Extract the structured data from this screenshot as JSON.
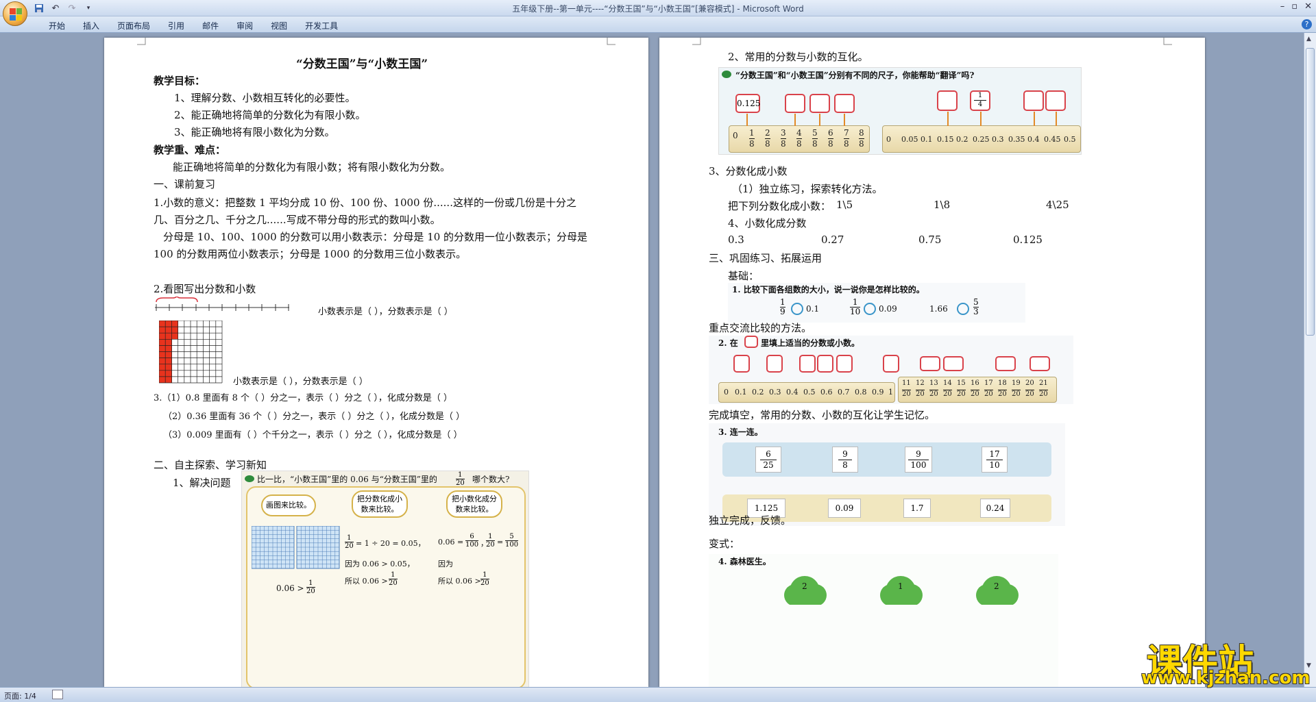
{
  "window": {
    "title": "五年级下册--第一单元----“分数王国”与“小数王国”[兼容模式] - Microsoft Word"
  },
  "ribbon": {
    "tabs": [
      "开始",
      "插入",
      "页面布局",
      "引用",
      "邮件",
      "审阅",
      "视图",
      "开发工具"
    ]
  },
  "status": {
    "page": "页面: 1/4"
  },
  "watermark": {
    "line1": "课件站",
    "line2": "www.kjzhan.com"
  },
  "page1": {
    "title": "“分数王国”与“小数王国”",
    "goals_heading": "教学目标：",
    "goals": [
      "1、理解分数、小数相互转化的必要性。",
      "2、能正确地将简单的分数化为有限小数。",
      "3、能正确地将有限小数化为分数。"
    ],
    "key_heading": "教学重、难点：",
    "key_text": "能正确地将简单的分数化为有限小数；将有限小数化为分数。",
    "sec1": "一、课前复习",
    "p1a": "1.小数的意义：把整数 1 平均分成 10 份、100 份、1000 份......这样的一份或几份是十分之",
    "p1b": "几、百分之几、千分之几......写成不带分母的形式的数叫小数。",
    "p2a": "分母是 10、100、1000 的分数可以用小数表示：分母是 10 的分数用一位小数表示；分母是",
    "p2b": "100 的分数用两位小数表示；分母是 1000 的分数用三位小数表示。",
    "q2": "2.看图写出分数和小数",
    "q2a": "小数表示是（        ），分数表示是（        ）",
    "q2b": "小数表示是（        ），分数表示是（        ）",
    "q3": [
      "3.（1）0.8 里面有 8 个（  ）分之一，表示（    ）分之（    ），化成分数是（    ）",
      "（2）0.36 里面有 36 个（    ）分之一，表示（    ）分之（    ），化成分数是（    ）",
      "（3）0.009 里面有（    ）个千分之一，表示（    ）分之（    ），化成分数是（    ）"
    ],
    "sec2": "二、自主探索、学习新知",
    "solve": "1、解决问题",
    "fig_title": "比一比，“小数王国”里的 0.06 与“分数王国”里的",
    "fig_tail": "哪个数大?",
    "frac_1_20": {
      "n": "1",
      "d": "20"
    },
    "bubble1": "画图来比较。",
    "bubble2": "把分数化成小数来比较。",
    "bubble3": "把小数化成分数来比较。",
    "fig_expr1": "0.06 >",
    "fig_col2": [
      "= 1 ÷ 20 = 0.05，",
      "因为 0.06 > 0.05，",
      "所以 0.06 >"
    ],
    "fig_col3": [
      "0.06 =",
      "，",
      "=",
      "，",
      "因为",
      "所以 0.06 >"
    ],
    "frac_6_100": {
      "n": "6",
      "d": "100"
    },
    "frac_5_100": {
      "n": "5",
      "d": "100"
    }
  },
  "page2": {
    "l1": "2、常用的分数与小数的互化。",
    "fig1_title": "“分数王国”和“小数王国”分别有不同的尺子，你能帮助“翻译”吗?",
    "fig1_given_decimal": "0.125",
    "fig1_given_frac": {
      "n": "1",
      "d": "4"
    },
    "ruler1_num": [
      "0",
      "1",
      "2",
      "3",
      "4",
      "5",
      "6",
      "7",
      "8"
    ],
    "ruler1_den": "8",
    "ruler2": [
      "0",
      "0.05",
      "0.1",
      "0.15",
      "0.2",
      "0.25",
      "0.3",
      "0.35",
      "0.4",
      "0.45",
      "0.5"
    ],
    "l3": "3、分数化成小数",
    "l3a": "（1）独立练习，探索转化方法。",
    "l3b": "把下列分数化成小数：",
    "l3b_items": [
      "1\\5",
      "1\\8",
      "4\\25"
    ],
    "l4": "4、小数化成分数",
    "l4_items": [
      "0.3",
      "0.27",
      "0.75",
      "0.125"
    ],
    "sec3": "三、巩固练习、拓展运用",
    "basic": "基础：",
    "cmp_title": "1. 比较下面各组数的大小，说一说你是怎样比较的。",
    "cmp": [
      {
        "n": "1",
        "d": "9",
        "v": "0.1"
      },
      {
        "n": "1",
        "d": "10",
        "v": "0.09"
      },
      {
        "v0": "1.66",
        "n": "5",
        "d": "3"
      }
    ],
    "exchange": "重点交流比较的方法。",
    "fill_title_a": "2. 在",
    "fill_title_b": "里填上适当的分数或小数。",
    "ruler3": [
      "0",
      "0.1",
      "0.2",
      "0.3",
      "0.4",
      "0.5",
      "0.6",
      "0.7",
      "0.8",
      "0.9",
      "1"
    ],
    "ruler4_num": [
      "11",
      "12",
      "13",
      "14",
      "15",
      "16",
      "17",
      "18",
      "19",
      "20",
      "21"
    ],
    "ruler4_den": "20",
    "fill_note": "完成填空，常用的分数、小数的互化让学生记忆。",
    "link_title": "3. 连一连。",
    "link_top": [
      {
        "n": "6",
        "d": "25"
      },
      {
        "n": "9",
        "d": "8"
      },
      {
        "n": "9",
        "d": "100"
      },
      {
        "n": "17",
        "d": "10"
      }
    ],
    "link_bottom": [
      "1.125",
      "0.09",
      "1.7",
      "0.24"
    ],
    "indep": "独立完成，反馈。",
    "variant": "变式：",
    "forest": "4. 森林医生。",
    "forest_nums": [
      "2",
      "1",
      "2"
    ]
  }
}
